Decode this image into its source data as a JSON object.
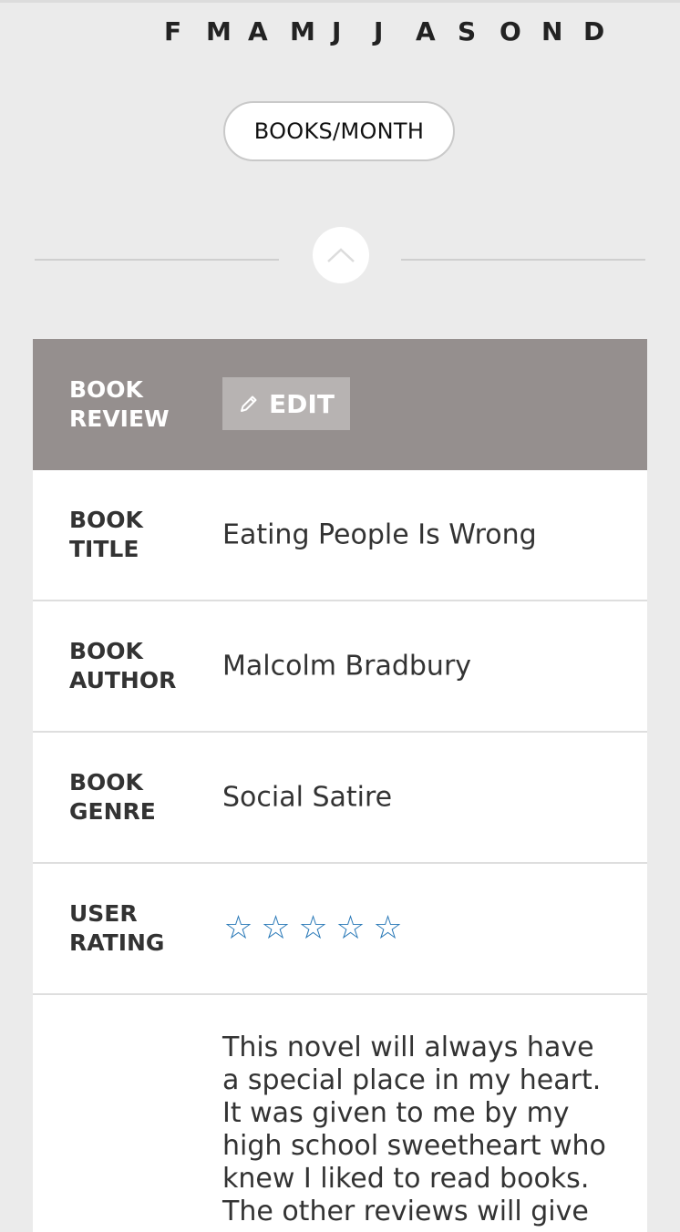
{
  "months": [
    "F",
    "M",
    "A",
    "M",
    "J",
    "J",
    "A",
    "S",
    "O",
    "N",
    "D"
  ],
  "toggle_button": {
    "label": "BOOKS/MONTH"
  },
  "collapse_button": {
    "icon": "chevron-up-icon"
  },
  "review_table": {
    "header": {
      "label": "BOOK\nREVIEW",
      "edit_label": "EDIT",
      "edit_icon": "pencil-icon"
    },
    "rows": [
      {
        "label": "BOOK\nTITLE",
        "value": "Eating People Is Wrong"
      },
      {
        "label": "BOOK\nAUTHOR",
        "value": "Malcolm Bradbury"
      },
      {
        "label": "BOOK\nGENRE",
        "value": "Social Satire"
      }
    ],
    "rating": {
      "label": "USER\nRATING",
      "stars": [
        "☆",
        "☆",
        "☆",
        "☆",
        "☆"
      ],
      "filled": 0,
      "max": 5
    },
    "review_text": "This novel will always have a special place in my heart. It was given to me by my high school sweetheart who knew I liked to read books. The other reviews will give"
  },
  "colors": {
    "background": "#ebebeb",
    "header_bg": "#958f8e",
    "edit_button_bg": "#b7b3b2",
    "star_color": "#2b7ab8"
  }
}
